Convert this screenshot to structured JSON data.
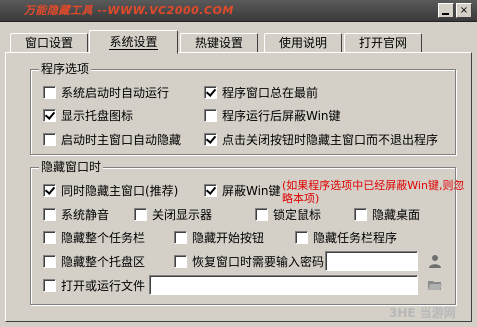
{
  "window": {
    "title": "万能隐藏工具 --WWW.VC2000.COM",
    "minimize_label": "_",
    "close_label": "×"
  },
  "tabs": [
    {
      "label": "窗口设置",
      "active": false
    },
    {
      "label": "系统设置",
      "active": true
    },
    {
      "label": "热键设置",
      "active": false
    },
    {
      "label": "使用说明",
      "active": false
    },
    {
      "label": "打开官网",
      "active": false
    }
  ],
  "program_options": {
    "title": "程序选项",
    "items": [
      {
        "label": "系统启动时自动运行",
        "checked": false
      },
      {
        "label": "程序窗口总在最前",
        "checked": true
      },
      {
        "label": "显示托盘图标",
        "checked": true
      },
      {
        "label": "程序运行后屏蔽Win键",
        "checked": false
      },
      {
        "label": "启动时主窗口自动隐藏",
        "checked": false
      },
      {
        "label": "点击关闭按钮时隐藏主窗口而不退出程序",
        "checked": true
      }
    ]
  },
  "hide_options": {
    "title": "隐藏窗口时",
    "items": [
      {
        "label": "同时隐藏主窗口(推荐)",
        "checked": true
      },
      {
        "label": "屏蔽Win键",
        "checked": true
      },
      {
        "label": "系统静音",
        "checked": false
      },
      {
        "label": "关闭显示器",
        "checked": false
      },
      {
        "label": "锁定鼠标",
        "checked": false
      },
      {
        "label": "隐藏桌面",
        "checked": false
      },
      {
        "label": "隐藏整个任务栏",
        "checked": false
      },
      {
        "label": "隐藏开始按钮",
        "checked": false
      },
      {
        "label": "隐藏任务栏程序",
        "checked": false
      },
      {
        "label": "隐藏整个托盘区",
        "checked": false
      },
      {
        "label": "恢复窗口时需要输入密码",
        "checked": false
      },
      {
        "label": "打开或运行文件",
        "checked": false
      }
    ],
    "note": "(如果程序选项中已经屏蔽Win键,则忽略本项)",
    "password_value": "",
    "file_value": ""
  },
  "watermark": "3HE 当游网",
  "icons": {
    "user": "user-icon",
    "folder": "folder-open-icon"
  }
}
